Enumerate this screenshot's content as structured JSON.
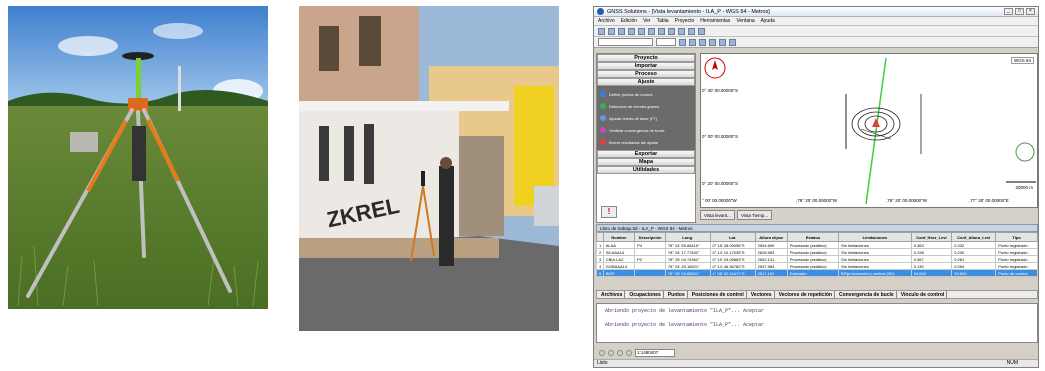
{
  "app": {
    "title": "GNSS Solutions - [Vista levantamiento - ILA_P - WGS 84 - Metros]",
    "menu": [
      "Archivo",
      "Edición",
      "Ver",
      "Tabla",
      "Proyecto",
      "Herramientas",
      "Ventana",
      "Ayuda"
    ],
    "sections": {
      "proyecto": "Proyecto",
      "importar": "Importar",
      "proceso": "Proceso",
      "ajuste": "Ajuste",
      "exportar": "Exportar",
      "mapa": "Mapa",
      "utilidades": "Utilidades"
    },
    "ajuste_items": [
      {
        "label": "Definir puntos de control",
        "color": "#3a7be0"
      },
      {
        "label": "Detección de errores graves",
        "color": "#32b44a"
      },
      {
        "label": "Ajustar líneas de base (F7)",
        "color": "#5a9ae8"
      },
      {
        "label": "Verificar convergencia de bucle",
        "color": "#c04ac0"
      },
      {
        "label": "Borrar resultados del ajuste",
        "color": "#e04040"
      }
    ],
    "map": {
      "datum_label": "WGS 84",
      "y_labels": [
        "0° 40' 00.00000\"S",
        "0° 00' 00.00000\"S",
        "0° 20' 00.00000\"S"
      ],
      "x_labels": [
        "° 00' 00.00000\"W",
        ",79° 20' 00.00000\"W",
        ",78° 20' 00.00000\"W",
        ",77° 30' 00.00000\"E"
      ],
      "scale_text": "20000 m"
    },
    "view_tabs": [
      "Vista levant...",
      "Vista Tiemp..."
    ],
    "table_title": "Libro de trabajo.ttd - ILA_P - WGS 84 - Metros",
    "columns": [
      "",
      "Nombre",
      "Descripción",
      "Long.",
      "Lat.",
      "Altura elipse",
      "Estatus",
      "Limitaciones",
      "Conf_Horz_Levl",
      "Conf_Altura_Levl",
      "Tipo"
    ],
    "rows": [
      [
        "1",
        "ALAA",
        "P4",
        "78° 24' 55.66415\"",
        "0° 18' 28.09096\"S",
        "2594.690",
        "Procesado (estático)",
        "Sin limitaciones",
        "0.363",
        "0.332",
        "Punto registrado"
      ],
      [
        "2",
        "SILAAA14",
        "",
        "78° 24' 17.77402\"",
        "0° 14' 10.17035\"S",
        "2626.983",
        "Procesado (estático)",
        "Sin limitaciones",
        "0.198",
        "0.230",
        "Punto registrado"
      ],
      [
        "3",
        "CBIA.LAZ",
        "P2",
        "78° 25' 04.74362\"",
        "0° 15' 03.09863\"S",
        "2652.131",
        "Procesado (estático)",
        "Sin limitaciones",
        "0.367",
        "0.281",
        "Punto registrado"
      ],
      [
        "4",
        "GOBAAA14",
        "",
        "78° 24' 49.16521\"",
        "0° 14' 46.36782\"S",
        "2597.984",
        "Procesado (estático)",
        "Sin limitaciones",
        "0.130",
        "0.064",
        "Punto registrado"
      ],
      [
        "5",
        "BIDF",
        "",
        "78° 08' 03.66531\"",
        "1° 08' 02.14471\"S",
        "2517.192",
        "Estimado",
        "BFija horizontal y vertical (3D)",
        "04.640",
        "19.600",
        "Punto de control"
      ]
    ],
    "bottom_tabs": [
      "Archivos",
      "Ocupaciones",
      "Puntos",
      "Posiciones de control",
      "Vectores",
      "Vectores de repetición",
      "Convergencia de bucle",
      "Vínculo de control"
    ],
    "console_lines": [
      "Abriendo proyecto de levantamiento \"ILA_P\"... Aceptar",
      "Abriendo proyecto de levantamiento \"ILA_P\"... Aceptar"
    ],
    "zoom_value": "1:1480407",
    "status_left": "Listo",
    "status_num": "NUM"
  }
}
